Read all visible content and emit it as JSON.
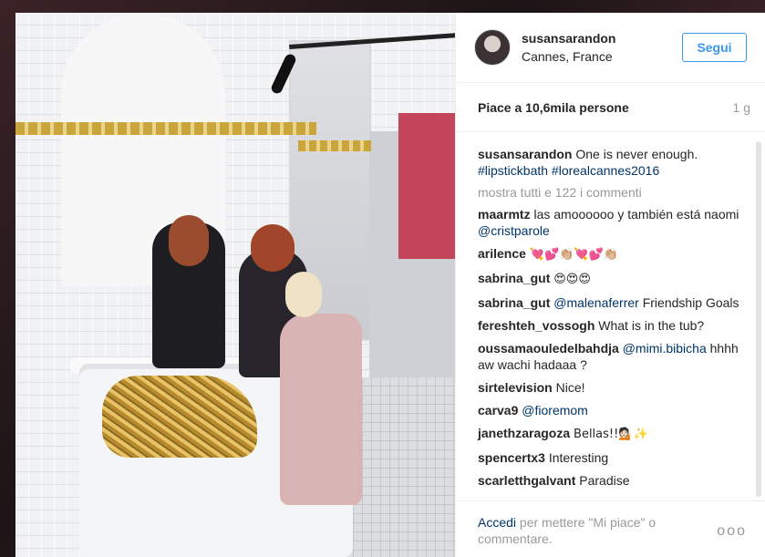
{
  "post": {
    "username": "susansarandon",
    "location": "Cannes, France",
    "follow_label": "Segui",
    "likes": "Piace a 10,6mila persone",
    "time": "1 g",
    "caption": {
      "user": "susansarandon",
      "text": "One is never enough.",
      "tags": "#lipstickbath #lorealcannes2016"
    },
    "load_more": "mostra tutti e 122 i commenti"
  },
  "comments": [
    {
      "user": "maarmtz",
      "text": "las amoooooo y también está naomi",
      "tag": "@cristparole"
    },
    {
      "user": "arilence",
      "text": "💘💕👏🏼💘💕👏🏼",
      "tag": ""
    },
    {
      "user": "sabrina_gut",
      "text": "😍😍😍",
      "tag": ""
    },
    {
      "user": "sabrina_gut",
      "text": "",
      "tag": "@malenaferrer",
      "after": "Friendship Goals"
    },
    {
      "user": "fereshteh_vossogh",
      "text": "What is in the tub?",
      "tag": ""
    },
    {
      "user": "oussamaouledelbahdja",
      "text": "",
      "tag": "@mimi.bibicha",
      "after": "hhhh aw wachi hadaaa ?"
    },
    {
      "user": "sirtelevision",
      "text": "Nice!",
      "tag": ""
    },
    {
      "user": "carva9",
      "text": "",
      "tag": "@fioremom",
      "after": ""
    },
    {
      "user": "janethzaragoza",
      "text": "Bellas!!💁🏻✨",
      "tag": ""
    },
    {
      "user": "spencertx3",
      "text": "Interesting",
      "tag": ""
    },
    {
      "user": "scarletthgalvant",
      "text": "Paradise",
      "tag": ""
    }
  ],
  "footer": {
    "login": "Accedi",
    "text": "per mettere \"Mi piace\" o commentare.",
    "more": "ooo"
  }
}
